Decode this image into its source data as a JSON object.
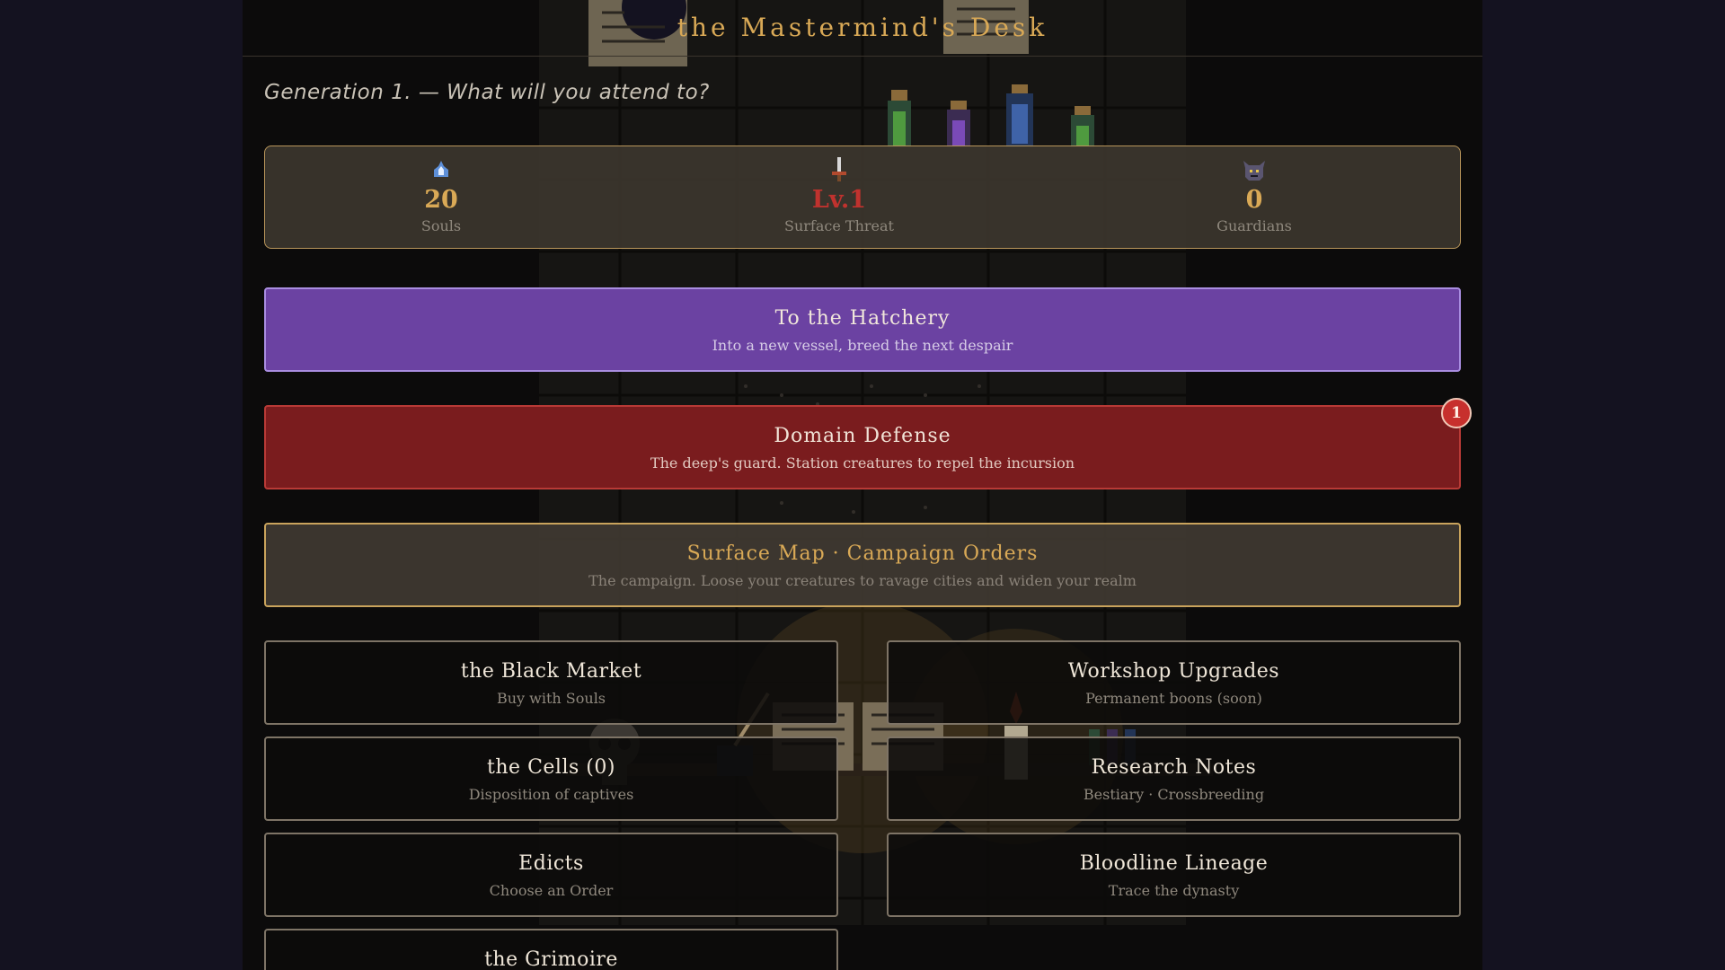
{
  "header": {
    "title": "the Mastermind's Desk"
  },
  "subtitle": "Generation 1. — What will you attend to?",
  "stats": [
    {
      "icon": "soul-flame-icon",
      "value": "20",
      "label": "Souls"
    },
    {
      "icon": "sword-icon",
      "value": "Lv.1",
      "label": "Surface Threat"
    },
    {
      "icon": "demon-head-icon",
      "value": "0",
      "label": "Guardians"
    }
  ],
  "actions": {
    "hatchery": {
      "title": "To the Hatchery",
      "subtitle": "Into a new vessel, breed the next despair"
    },
    "defense": {
      "title": "Domain Defense",
      "subtitle": "The deep's guard. Station creatures to repel the incursion",
      "badge": "1"
    },
    "surface": {
      "title": "Surface Map · Campaign Orders",
      "subtitle": "The campaign. Loose your creatures to ravage cities and widen your realm"
    }
  },
  "menu": [
    {
      "title": "the Black Market",
      "subtitle": "Buy with Souls"
    },
    {
      "title": "Workshop Upgrades",
      "subtitle": "Permanent boons (soon)"
    },
    {
      "title": "the Cells (0)",
      "subtitle": "Disposition of captives"
    },
    {
      "title": "Research Notes",
      "subtitle": "Bestiary · Crossbreeding"
    },
    {
      "title": "Edicts",
      "subtitle": "Choose an Order"
    },
    {
      "title": "Bloodline Lineage",
      "subtitle": "Trace the dynasty"
    },
    {
      "title": "the Grimoire",
      "subtitle": ""
    }
  ],
  "colors": {
    "background": "#141220",
    "panel": "#0c0b0b",
    "gold": "#d9a956",
    "hatchery": "#6b42a2",
    "defense": "#7a1c1e",
    "threat": "#c0322e"
  }
}
